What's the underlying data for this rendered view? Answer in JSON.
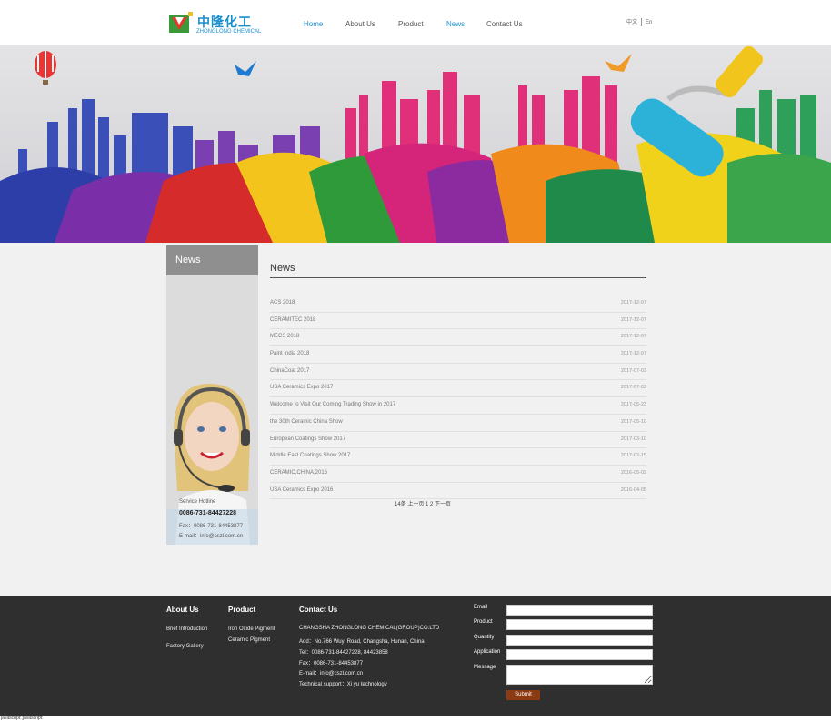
{
  "header": {
    "logo_cn": "中隆化工",
    "logo_en": "ZHONGLONG CHEMICAL",
    "nav": [
      {
        "label": "Home",
        "active": true
      },
      {
        "label": "About Us",
        "active": false
      },
      {
        "label": "Product",
        "active": false
      },
      {
        "label": "News",
        "active": true
      },
      {
        "label": "Contact Us",
        "active": false
      }
    ],
    "lang_cn": "中文",
    "lang_en": "En"
  },
  "sidebar": {
    "title": "News",
    "hotline_label": "Service Hotline",
    "hotline_number": "0086-731-84427228",
    "fax": "Fax：0086-731-84453877",
    "email": "E-mail：info@cszl.com.cn"
  },
  "main": {
    "title": "News",
    "news": [
      {
        "title": "ACS 2018",
        "date": "2017-12-07"
      },
      {
        "title": "CERAMITEC 2018",
        "date": "2017-12-07"
      },
      {
        "title": "MECS 2018",
        "date": "2017-12-07"
      },
      {
        "title": "Paint India 2018",
        "date": "2017-12-07"
      },
      {
        "title": "ChinaCoat 2017",
        "date": "2017-07-03"
      },
      {
        "title": "USA Ceramics Expo 2017",
        "date": "2017-07-03"
      },
      {
        "title": "Welcome to Visit Our Coming Trading Show in 2017",
        "date": "2017-05-23"
      },
      {
        "title": "the 30th Ceramic China Show",
        "date": "2017-05-10"
      },
      {
        "title": "European Coatings Show 2017",
        "date": "2017-03-10"
      },
      {
        "title": "Middle East Coatings Show 2017",
        "date": "2017-02-15"
      },
      {
        "title": "CERAMIC,CHINA,2016",
        "date": "2016-05-02"
      },
      {
        "title": "USA Ceramics Expo 2016",
        "date": "2016-04-05"
      }
    ],
    "pager": "14条 上一页 1 2 下一页"
  },
  "footer": {
    "about_head": "About Us",
    "about_links": [
      "Brief Introduction",
      "Factory Gallery"
    ],
    "product_head": "Product",
    "product_links": [
      "Iron Oxide Pigment",
      "Ceramic Pigment"
    ],
    "contact_head": "Contact Us",
    "contact_lines": [
      "CHANGSHA ZHONGLONG CHEMICAL(GROUP)CO.LTD",
      "Add：No.766 Wuyi Road, Changsha, Hunan, China",
      "Tel：0086-731-84427228, 84423858",
      "Fax：0086-731-84453877",
      "E-mail：info@cszl.com.cn",
      "Technical support：Xi yu technology"
    ],
    "form_labels": [
      "Email",
      "Product",
      "Quantity",
      "Application",
      "Message"
    ],
    "submit_label": "Submit"
  },
  "status_bar": "javascript:;javascript:",
  "colors": {
    "accent": "#1a8fd0",
    "footer_bg": "#2f2f2f",
    "submit": "#8b3a12"
  }
}
